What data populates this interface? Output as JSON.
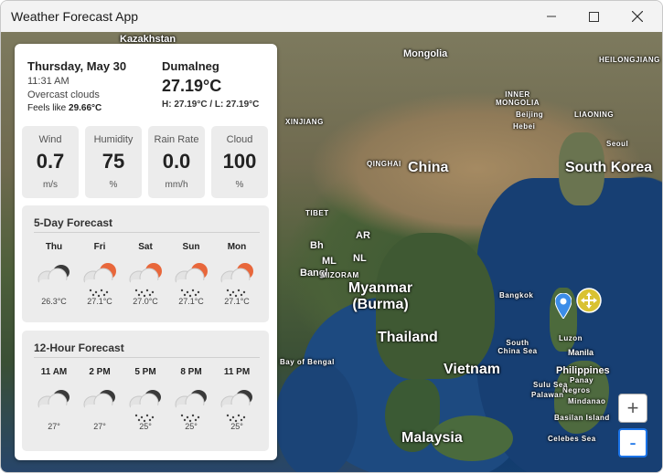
{
  "window": {
    "title": "Weather Forecast App"
  },
  "current": {
    "date": "Thursday, May 30",
    "time": "11:31 AM",
    "condition": "Overcast clouds",
    "feels_label": "Feels like ",
    "feels_value": "29.66°C",
    "city": "Dumalneg",
    "temperature": "27.19°C",
    "hilo": "H: 27.19°C / L: 27.19°C"
  },
  "stats": [
    {
      "label": "Wind",
      "value": "0.7",
      "unit": "m/s"
    },
    {
      "label": "Humidity",
      "value": "75",
      "unit": "%"
    },
    {
      "label": "Rain Rate",
      "value": "0.0",
      "unit": "mm/h"
    },
    {
      "label": "Cloud",
      "value": "100",
      "unit": "%"
    }
  ],
  "five_day": {
    "title": "5-Day Forecast",
    "days": [
      {
        "label": "Thu",
        "temp": "26.3°C",
        "icon": "overcast-cloud-icon"
      },
      {
        "label": "Fri",
        "temp": "27.1°C",
        "icon": "sun-rain-cloud-icon"
      },
      {
        "label": "Sat",
        "temp": "27.0°C",
        "icon": "sun-rain-cloud-icon"
      },
      {
        "label": "Sun",
        "temp": "27.1°C",
        "icon": "sun-rain-cloud-icon"
      },
      {
        "label": "Mon",
        "temp": "27.1°C",
        "icon": "sun-rain-cloud-icon"
      }
    ]
  },
  "twelve_hour": {
    "title": "12-Hour Forecast",
    "hours": [
      {
        "label": "11 AM",
        "temp": "27°",
        "icon": "overcast-cloud-icon"
      },
      {
        "label": "2 PM",
        "temp": "27°",
        "icon": "overcast-cloud-icon"
      },
      {
        "label": "5 PM",
        "temp": "25°",
        "icon": "rain-cloud-icon"
      },
      {
        "label": "8 PM",
        "temp": "25°",
        "icon": "rain-cloud-icon"
      },
      {
        "label": "11 PM",
        "temp": "25°",
        "icon": "rain-cloud-icon"
      }
    ]
  },
  "map": {
    "labels": [
      "Kazakhstan",
      "Mongolia",
      "China",
      "South Korea",
      "Myanmar (Burma)",
      "Thailand",
      "Vietnam",
      "Malaysia",
      "Philippines",
      "Manila",
      "Luzon",
      "South China Sea",
      "Bangkok",
      "Beijing",
      "Bangl",
      "Bh",
      "AR",
      "ML",
      "NL",
      "MIZORAM",
      "TIBET",
      "QINGHAI",
      "INNER MONGOLIA",
      "HEILONGJIANG",
      "LIAONING",
      "XINJIANG",
      "Bay of Bengal",
      "Panay",
      "Negros",
      "Palawan",
      "Mindanao",
      "Basilan Island",
      "Celebes Sea",
      "Sulu Sea",
      "Hebei",
      "Seoul"
    ],
    "zoom_in": "+",
    "zoom_out": "-"
  },
  "colors": {
    "accent": "#1a73e8",
    "sun": "#e8673b",
    "cloud_dark": "#3a3a3a"
  }
}
